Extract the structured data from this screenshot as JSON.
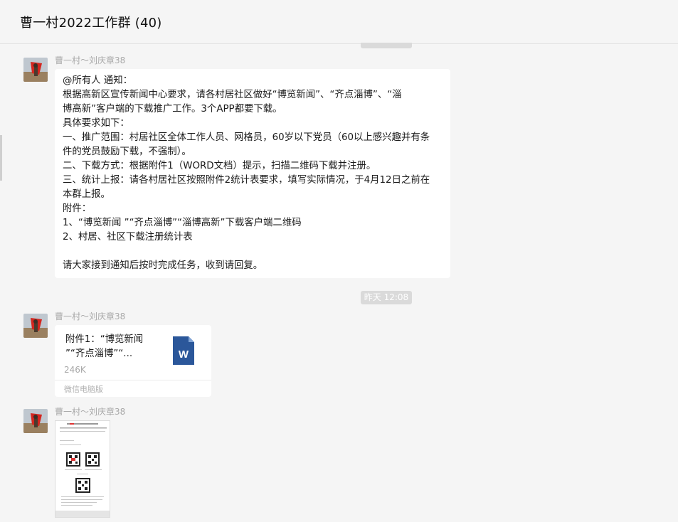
{
  "chat": {
    "title": "曹一村2022工作群 (40)"
  },
  "messages": [
    {
      "sender": "曹一村～刘庆章38",
      "lines": [
        "@所有人 通知：",
        "根据高新区宣传新闻中心要求，请各村居社区做好“博览新闻”、“齐点淄博”、“淄",
        "博高新”客户端的下载推广工作。3个APP都要下载。",
        "具体要求如下：",
        "一、推广范围：村居社区全体工作人员、网格员，60岁以下党员（60以上感兴趣并有条",
        "件的党员鼓励下载，不强制）。",
        "二、下载方式：根据附件1（WORD文档）提示，扫描二维码下载并注册。",
        "三、统计上报：请各村居社区按照附件2统计表要求，填写实际情况，于4月12日之前在",
        "本群上报。",
        "附件：",
        "1、“博览新闻 ”“齐点淄博”“淄博高新”下载客户端二维码",
        "2、村居、社区下载注册统计表",
        "",
        "请大家接到通知后按时完成任务，收到请回复。"
      ]
    },
    {
      "sender": "曹一村～刘庆章38",
      "file": {
        "name_line1": "附件1：“博览新闻",
        "name_line2": "”“齐点淄博”“...",
        "size": "246K",
        "source": "微信电脑版",
        "icon": "word-file-icon"
      }
    },
    {
      "sender": "曹一村～刘庆章38",
      "image": {
        "icon": "document-image-thumbnail"
      }
    }
  ],
  "timestamp": "昨天 12:08",
  "colors": {
    "background": "#f5f5f5",
    "bubble": "#ffffff",
    "word_blue": "#2b579a",
    "timestamp_bg": "#dadada"
  }
}
